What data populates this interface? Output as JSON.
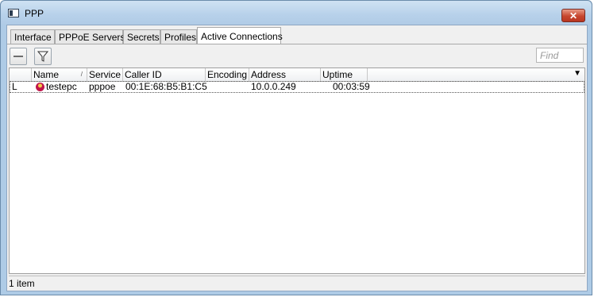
{
  "window": {
    "title": "PPP",
    "close_label": "✕"
  },
  "tabs": [
    {
      "label": "Interface",
      "active": false
    },
    {
      "label": "PPPoE Servers",
      "active": false
    },
    {
      "label": "Secrets",
      "active": false
    },
    {
      "label": "Profiles",
      "active": false
    },
    {
      "label": "Active Connections",
      "active": true
    }
  ],
  "toolbar": {
    "find_placeholder": "Find"
  },
  "table": {
    "columns": [
      "Name",
      "Service",
      "Caller ID",
      "Encoding",
      "Address",
      "Uptime"
    ],
    "sorted_column": "Name",
    "rows": [
      {
        "flag": "L",
        "name": "testepc",
        "service": "pppoe",
        "caller_id": "00:1E:68:B5:B1:C5",
        "encoding": "",
        "address": "10.0.0.249",
        "uptime": "00:03:59",
        "icon": "user-icon"
      }
    ]
  },
  "status": {
    "item_count": "1 item"
  },
  "colors": {
    "title_bar": "#b7d1ea",
    "close_button": "#c7472f",
    "user_icon": "#c0164b"
  }
}
